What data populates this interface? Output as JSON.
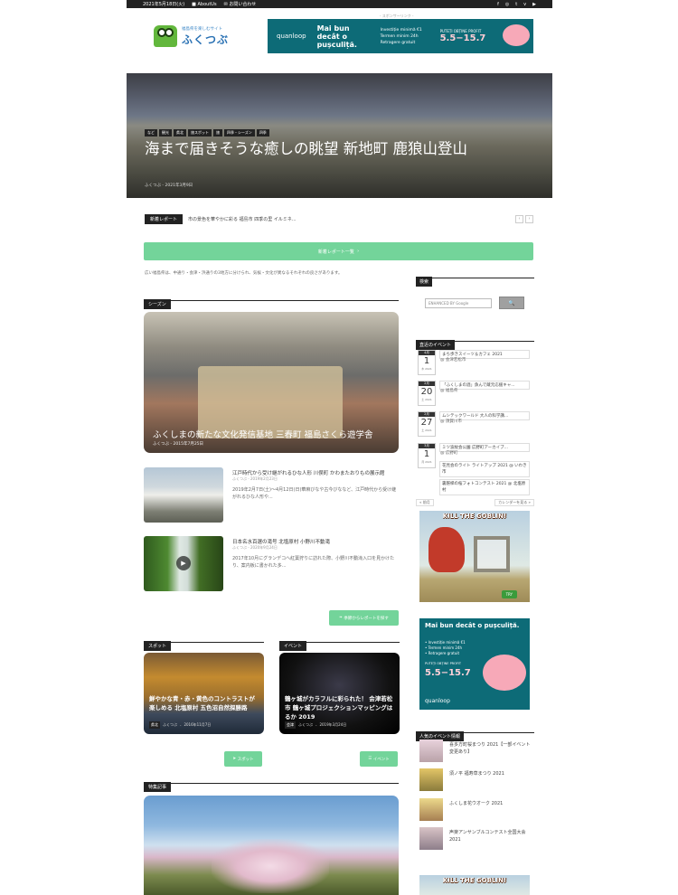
{
  "topbar": {
    "date": "2021年5月18日(火)",
    "about": "AboutUs",
    "contact": "お問い合わせ",
    "social": [
      "f",
      "◎",
      "t",
      "v",
      "▶"
    ]
  },
  "logo": {
    "sub": "福島県を楽しむサイト",
    "main": "ふくつぶ"
  },
  "ad_top": {
    "label": "- スポンサーリンク -",
    "brand": "quanloop",
    "headline": "Mai bun decât o pușculiță.",
    "bullets": [
      "Investiție minimă €1",
      "Termen minim 24h",
      "Retragere gratuit"
    ],
    "rate_label": "PUTEȚI OBȚINE PROFIT",
    "rate": "5.5−15.7"
  },
  "hero": {
    "tags": [
      "など",
      "観光",
      "県北",
      "旅スポット",
      "旅",
      "四季・シーズン",
      "四季"
    ],
    "title": "海まで届きそうな癒しの眺望 新地町 鹿狼山登山",
    "author": "ふくつぶ",
    "date": "2021年3月9日"
  },
  "ticker": {
    "label": "新着レポート",
    "text": "市の景色を華やかに彩る 福島市 四季の里 イルミネ...",
    "prev": "‹",
    "next": "›"
  },
  "new_button": "新着レポート一覧",
  "intro": "広い福島県は、中通り・会津・浜通りの3地方に分けられ、気候・文化が異なるそれぞれの良さがあります。",
  "season": {
    "heading": "シーズン",
    "big": {
      "title": "ふくしまの新たな文化発信基地 三春町 福島さくら遊学舎",
      "author": "ふくつぶ",
      "date": "2015年7月25日"
    },
    "items": [
      {
        "title": "江戸時代から受け継がれるひな人形 川俣町 かわまたおりもの展示館",
        "author": "ふくつぶ",
        "date": "2019年2月23日",
        "excerpt": "2019年2月7日(土)〜4月12日(日)華麻びなや古今びななど、江戸時代から受け継がれるひな人形や..."
      },
      {
        "title": "日本名水百選の滝号 北塩原村 小野川不動滝",
        "author": "ふくつぶ",
        "date": "2020年9月24日",
        "excerpt": "2017年10月にグランデコへ紅葉狩りに訪れた際、小野川不動滝入口を見かけたり、案内板に書かれた多..."
      }
    ],
    "more": "季節からレポートを探す"
  },
  "spot": {
    "heading": "スポット",
    "card": {
      "title": "鮮やかな青・赤・黄色のコントラストが楽しめる 北塩原村 五色沼自然探勝路",
      "tag": "県北",
      "author": "ふくつぶ",
      "date": "2016年11月7日"
    },
    "more": "スポット"
  },
  "event": {
    "heading": "イベント",
    "card": {
      "title": "鶴ヶ城がカラフルに彩られた！ 会津若松市 鶴ヶ城プロジェクションマッピングはるか 2019",
      "tag": "会津",
      "author": "ふくつぶ",
      "date": "2019年3月24日"
    },
    "more": "イベント"
  },
  "feature": {
    "heading": "特集記事"
  },
  "sidebar": {
    "search_heading": "検索",
    "search_placeholder": "ENHANCED BY Google",
    "search_button": "🔍",
    "events_heading": "直近のイベント",
    "events": [
      {
        "month": "4月",
        "day": "1",
        "dow": "木",
        "year": "2021",
        "title": "まち歩きスイーツ＆カフェ 2021",
        "loc": "@ 会津若松市"
      },
      {
        "month": "2月",
        "day": "20",
        "dow": "土",
        "year": "2021",
        "title": "「ふくしまの酒」魚んで蔵元応援キャ...",
        "loc": "@ 福島県"
      },
      {
        "month": "2月",
        "day": "27",
        "dow": "土",
        "year": "2021",
        "title": "ムシテックワールド 大人の科学講...",
        "loc": "@ 須賀川市"
      },
      {
        "month": "3月",
        "day": "1",
        "dow": "月",
        "year": "2021",
        "title": "ミツ波紋会公園 広野町アーカイブ...",
        "loc": "@ 広野町"
      }
    ],
    "extra_events": [
      "花見会のライト ライトアップ 2021 @ いわき市",
      "裏磐梯の桜フォトコンテスト 2021 @ 北塩原村"
    ],
    "cal_prev": "« 前月",
    "cal_next": "カレンダーを見る »",
    "ad_goblin_title": "KILL THE GOBLIN!",
    "ad_goblin_btn": "TRY",
    "ad_tile": {
      "headline": "Mai bun decât o pușculiță.",
      "bullets": "• Investiție minimă €1\n• Termen minim 24h\n• Retragere gratuit",
      "rate_label": "PUTEȚI OBȚINE PROFIT",
      "rate": "5.5−15.7",
      "brand": "quanloop"
    },
    "popular_heading": "人気のイベント情報",
    "popular": [
      "喜多方町桜まつり 2021【一部イベント変更あり】",
      "須ノ平 福寿草まつり 2021",
      "ふくしま花ウオーク 2021",
      "声楽アンサンブルコンテスト全国大会 2021"
    ]
  }
}
